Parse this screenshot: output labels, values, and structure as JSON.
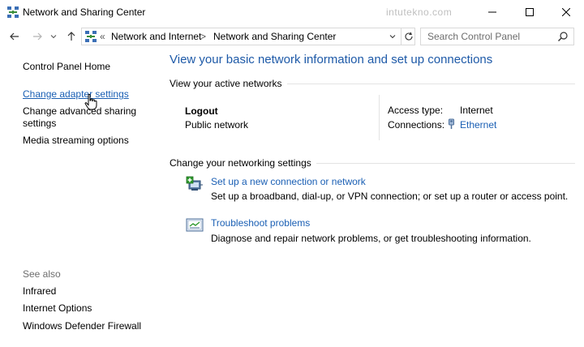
{
  "window": {
    "title": "Network and Sharing Center",
    "watermark": "intutekno.com"
  },
  "navigation": {
    "path_overflow": "«",
    "path_separator": ">",
    "breadcrumbs": [
      "Network and Internet",
      "Network and Sharing Center"
    ],
    "search_placeholder": "Search Control Panel"
  },
  "sidebar": {
    "home": "Control Panel Home",
    "change_adapter": "Change adapter settings",
    "change_advanced_line1": "Change advanced sharing",
    "change_advanced_line2": "settings",
    "media_streaming": "Media streaming options",
    "see_also_heading": "See also",
    "see_also": [
      "Infrared",
      "Internet Options",
      "Windows Defender Firewall"
    ]
  },
  "main": {
    "title": "View your basic network information and set up connections",
    "active_networks_heading": "View your active networks",
    "network": {
      "name": "Logout",
      "type": "Public network",
      "access_type_label": "Access type:",
      "access_type_value": "Internet",
      "connections_label": "Connections:",
      "connections_value": "Ethernet"
    },
    "change_settings_heading": "Change your networking settings",
    "tasks": [
      {
        "title": "Set up a new connection or network",
        "description": "Set up a broadband, dial-up, or VPN connection; or set up a router or access point.",
        "icon": "new-connection-icon"
      },
      {
        "title": "Troubleshoot problems",
        "description": "Diagnose and repair network problems, or get troubleshooting information.",
        "icon": "troubleshoot-icon"
      }
    ]
  },
  "colors": {
    "link": "#1a5fb4",
    "title_blue": "#1e5aa8",
    "muted_text": "#6d6d6d",
    "divider": "#e3e3e3"
  }
}
